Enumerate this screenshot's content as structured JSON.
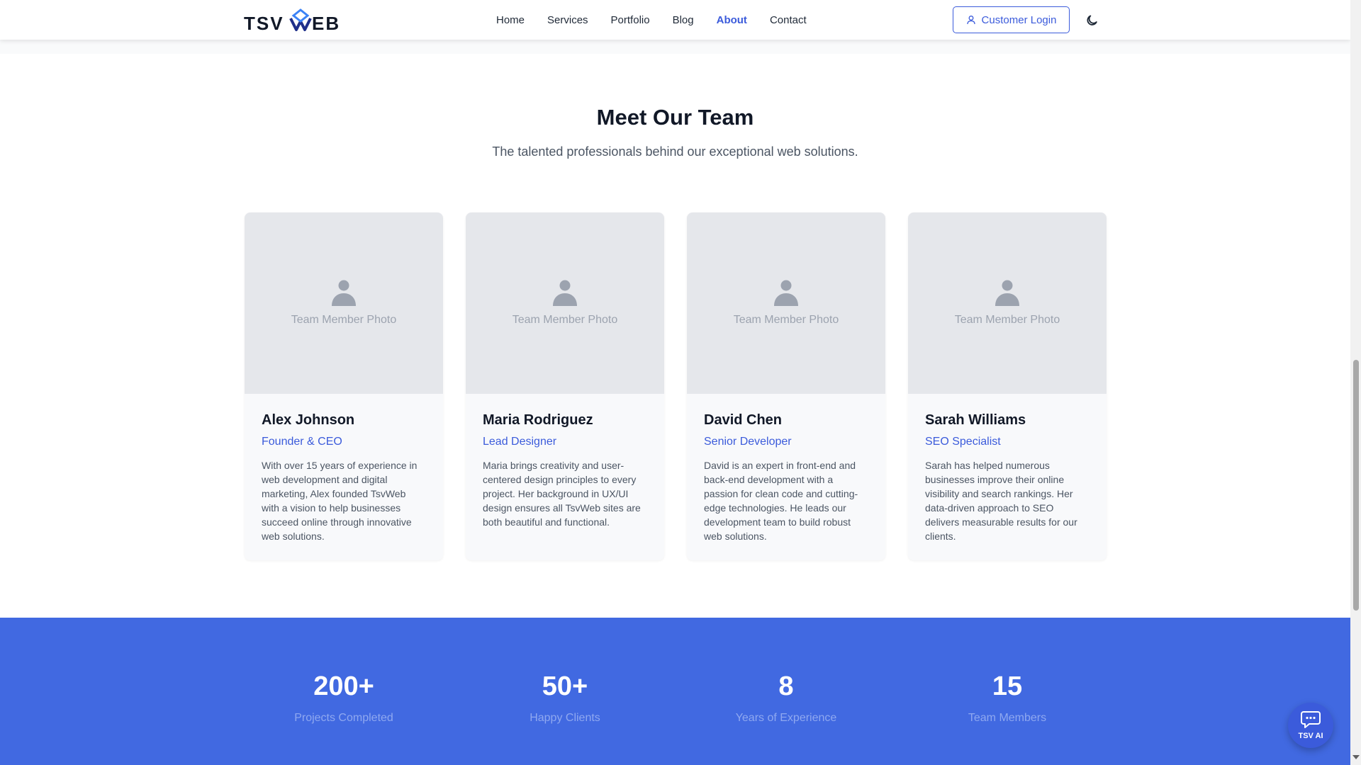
{
  "brand": {
    "logo_text": "TSVWEB",
    "accent": "#3b5bdb"
  },
  "nav": {
    "items": [
      {
        "label": "Home",
        "active": false
      },
      {
        "label": "Services",
        "active": false
      },
      {
        "label": "Portfolio",
        "active": false
      },
      {
        "label": "Blog",
        "active": false
      },
      {
        "label": "About",
        "active": true
      },
      {
        "label": "Contact",
        "active": false
      }
    ],
    "login_label": "Customer Login",
    "login_icon": "user-icon",
    "theme_icon": "moon-icon"
  },
  "team": {
    "title": "Meet Our Team",
    "subtitle": "The talented professionals behind our exceptional web solutions.",
    "photo_placeholder": "Team Member Photo",
    "members": [
      {
        "name": "Alex Johnson",
        "role": "Founder & CEO",
        "bio": "With over 15 years of experience in web development and digital marketing, Alex founded TsvWeb with a vision to help businesses succeed online through innovative web solutions."
      },
      {
        "name": "Maria Rodriguez",
        "role": "Lead Designer",
        "bio": "Maria brings creativity and user-centered design principles to every project. Her background in UX/UI design ensures all TsvWeb sites are both beautiful and functional."
      },
      {
        "name": "David Chen",
        "role": "Senior Developer",
        "bio": "David is an expert in front-end and back-end development with a passion for clean code and cutting-edge technologies. He leads our development team to build robust web solutions."
      },
      {
        "name": "Sarah Williams",
        "role": "SEO Specialist",
        "bio": "Sarah has helped numerous businesses improve their online visibility and search rankings. Her data-driven approach to SEO delivers measurable results for our clients."
      }
    ]
  },
  "stats": {
    "bg_color": "#4169e1",
    "items": [
      {
        "value": "200+",
        "label": "Projects Completed"
      },
      {
        "value": "50+",
        "label": "Happy Clients"
      },
      {
        "value": "8",
        "label": "Years of Experience"
      },
      {
        "value": "15",
        "label": "Team Members"
      }
    ]
  },
  "chat": {
    "label": "TSV AI",
    "icon": "chat-bubble-icon"
  }
}
